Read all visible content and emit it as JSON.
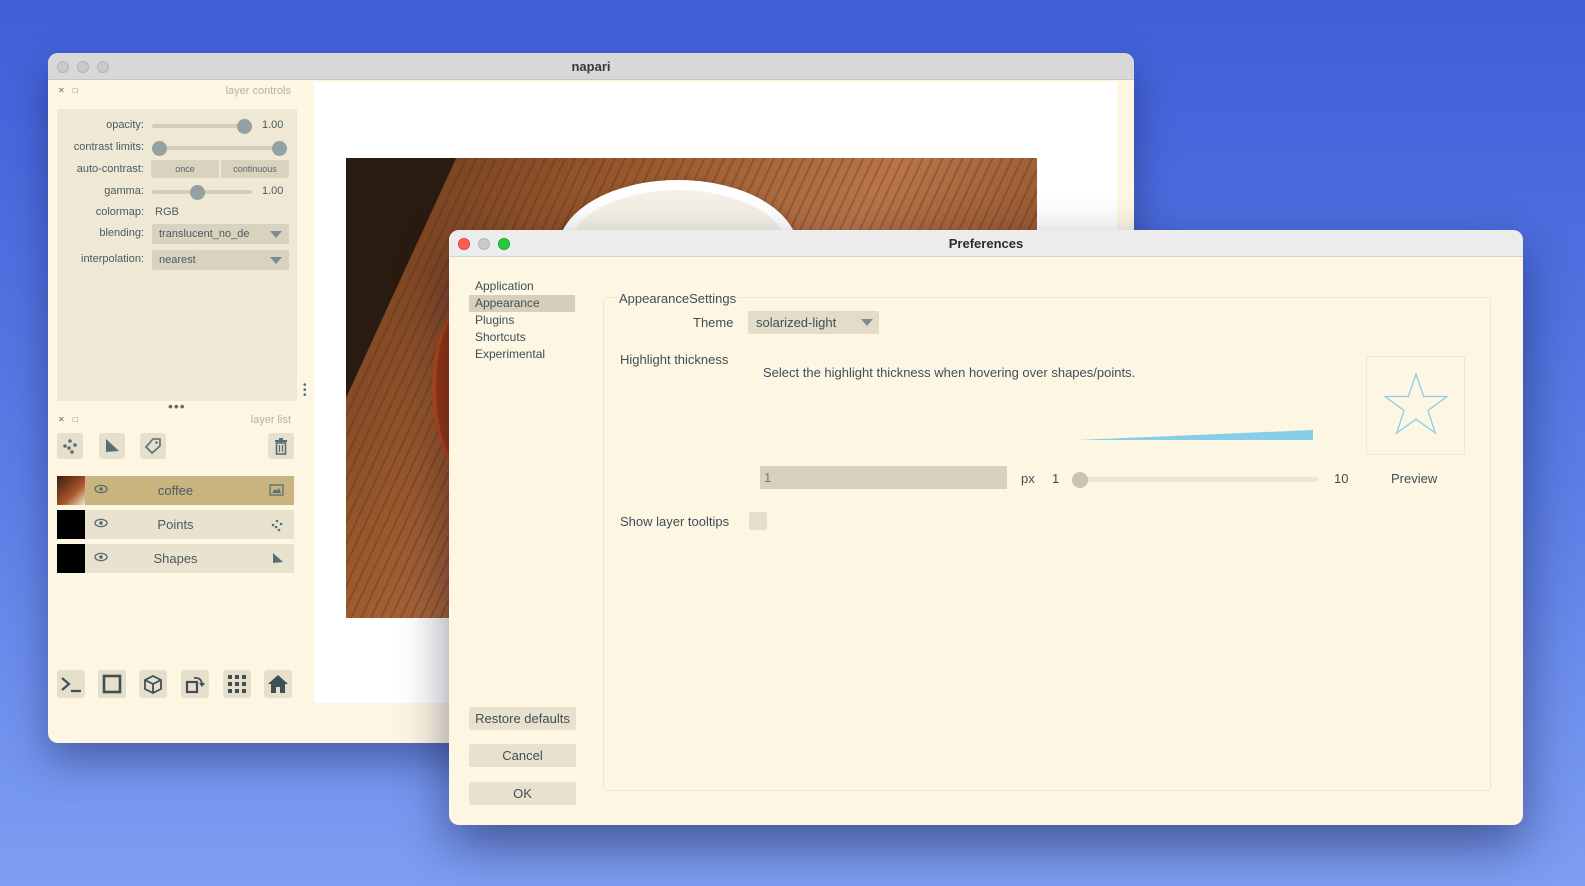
{
  "napari": {
    "window_title": "napari",
    "layer_controls": {
      "header": "layer controls",
      "opacity_label": "opacity:",
      "opacity_value": "1.00",
      "opacity_level": 1.0,
      "contrast_label": "contrast limits:",
      "auto_contrast_label": "auto-contrast:",
      "once_label": "once",
      "continuous_label": "continuous",
      "gamma_label": "gamma:",
      "gamma_value": "1.00",
      "colormap_label": "colormap:",
      "colormap_value": "RGB",
      "blending_label": "blending:",
      "blending_value": "translucent_no_de",
      "interpolation_label": "interpolation:",
      "interpolation_value": "nearest"
    },
    "layer_list": {
      "header": "layer list",
      "layers": [
        {
          "name": "coffee",
          "type_icon": "image-icon",
          "selected": true
        },
        {
          "name": "Points",
          "type_icon": "points-icon",
          "selected": false
        },
        {
          "name": "Shapes",
          "type_icon": "shapes-icon",
          "selected": false
        }
      ]
    },
    "colors": {
      "panel_bg": "#fdf6e3",
      "controls_bg": "#eee8d5",
      "selected_layer": "#c8b47c"
    }
  },
  "prefs": {
    "window_title": "Preferences",
    "nav": [
      "Application",
      "Appearance",
      "Plugins",
      "Shortcuts",
      "Experimental"
    ],
    "active_nav": "Appearance",
    "group_title": "AppearanceSettings",
    "theme_label": "Theme",
    "theme_value": "solarized-light",
    "highlight_label": "Highlight thickness",
    "highlight_description": "Select the highlight thickness when hovering over shapes/points.",
    "thickness_value": "1",
    "unit": "px",
    "slider_min": "1",
    "slider_max": "10",
    "slider_value": 1,
    "preview_label": "Preview",
    "tooltips_label": "Show layer tooltips",
    "restore_label": "Restore defaults",
    "cancel_label": "Cancel",
    "ok_label": "OK",
    "accent_color": "#87ceeb"
  }
}
